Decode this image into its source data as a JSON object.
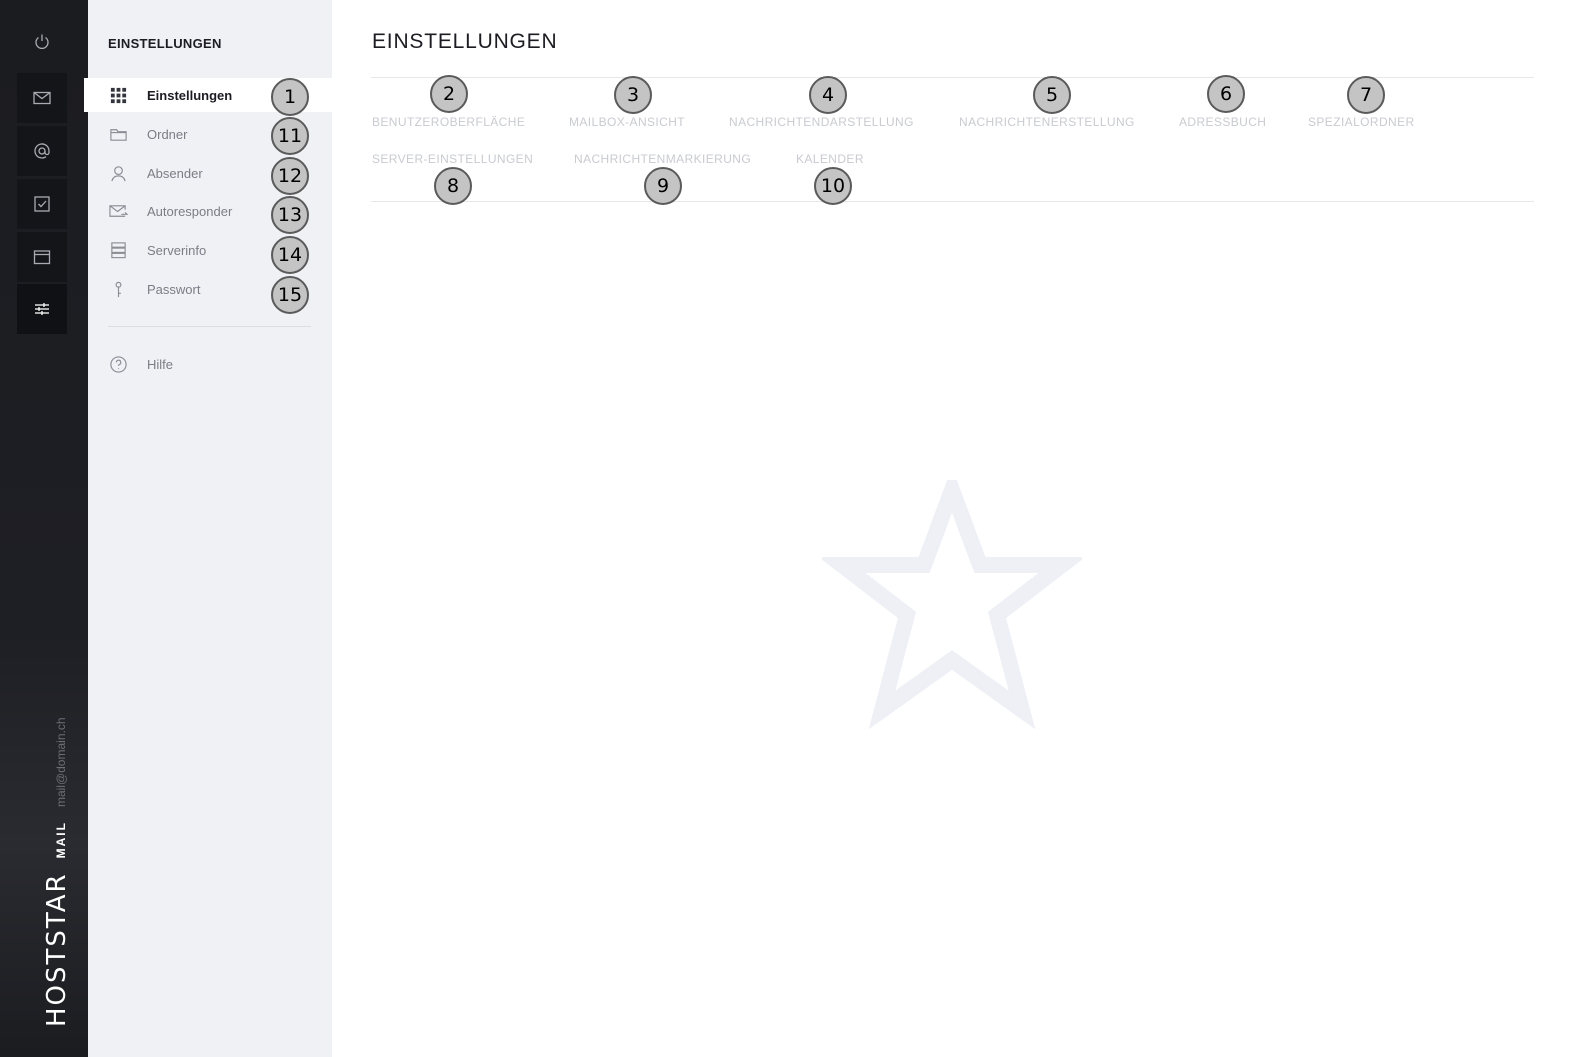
{
  "rail": {
    "brand": "HOSTSTAR",
    "product": "MAIL",
    "account": "mail@domain.ch",
    "buttons": [
      {
        "icon": "power-icon"
      },
      {
        "icon": "mail-icon"
      },
      {
        "icon": "at-icon"
      },
      {
        "icon": "tasks-icon"
      },
      {
        "icon": "calendar-icon"
      },
      {
        "icon": "settings-sliders-icon",
        "active": true
      }
    ]
  },
  "sidebar": {
    "title": "EINSTELLUNGEN",
    "items": [
      {
        "label": "Einstellungen",
        "icon": "grid-icon",
        "active": true,
        "badge": "1"
      },
      {
        "label": "Ordner",
        "icon": "folder-icon",
        "badge": "11"
      },
      {
        "label": "Absender",
        "icon": "user-icon",
        "badge": "12"
      },
      {
        "label": "Autoresponder",
        "icon": "autoresponder-icon",
        "badge": "13"
      },
      {
        "label": "Serverinfo",
        "icon": "server-icon",
        "badge": "14"
      },
      {
        "label": "Passwort",
        "icon": "key-icon",
        "badge": "15"
      }
    ],
    "help": {
      "label": "Hilfe",
      "icon": "help-icon"
    }
  },
  "main": {
    "title": "EINSTELLUNGEN",
    "tabs": [
      {
        "label": "BENUTZEROBERFLÄCHE",
        "badge": "2"
      },
      {
        "label": "MAILBOX-ANSICHT",
        "badge": "3"
      },
      {
        "label": "NACHRICHTENDARSTELLUNG",
        "badge": "4"
      },
      {
        "label": "NACHRICHTENERSTELLUNG",
        "badge": "5"
      },
      {
        "label": "ADRESSBUCH",
        "badge": "6"
      },
      {
        "label": "SPEZIALORDNER",
        "badge": "7"
      },
      {
        "label": "SERVER-EINSTELLUNGEN",
        "badge": "8"
      },
      {
        "label": "NACHRICHTENMARKIERUNG",
        "badge": "9"
      },
      {
        "label": "KALENDER",
        "badge": "10"
      }
    ]
  },
  "colors": {
    "rail_bg": "#1e1f24",
    "sidebar_bg": "#f0f1f5",
    "badge_bg": "#c4c4c4"
  }
}
